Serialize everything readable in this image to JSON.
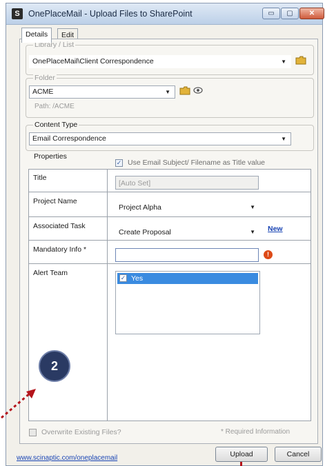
{
  "window": {
    "title": "OnePlaceMail - Upload Files to SharePoint",
    "app_icon": "S",
    "min_glyph": "▭",
    "max_glyph": "▢",
    "close_glyph": "✕"
  },
  "tabs": [
    {
      "label": "Details",
      "active": true
    },
    {
      "label": "Edit File List",
      "active": false
    }
  ],
  "library": {
    "legend": "Library / List",
    "value": "OnePlaceMail\\Client Correspondence"
  },
  "folder": {
    "legend": "Folder",
    "value": "ACME",
    "path": "Path:  /ACME"
  },
  "content_type": {
    "legend": "Content Type",
    "value": "Email Correspondence"
  },
  "properties": {
    "legend": "Properties",
    "use_subject_label": "Use Email Subject/ Filename as Title value",
    "use_subject_checked": true,
    "title_label": "Title",
    "title_value": "[Auto Set]",
    "project_label": "Project Name",
    "project_value": "Project Alpha",
    "task_label": "Associated Task",
    "task_value": "Create Proposal",
    "task_new_link": "New",
    "mandatory_label": "Mandatory Info *",
    "mandatory_value": "",
    "alert_label": "Alert Team",
    "alert_options": [
      {
        "label": "Yes",
        "checked": true
      }
    ]
  },
  "overwrite_label": "Overwrite Existing Files?",
  "required_note": "* Required Information",
  "footer_link": "www.scinaptic.com/oneplacemail",
  "upload_label": "Upload",
  "cancel_label": "Cancel",
  "badge_number": "2",
  "icons": {
    "dropdown": "▼",
    "folder": "folder-icon",
    "view": "view-icon",
    "warning": "!"
  }
}
